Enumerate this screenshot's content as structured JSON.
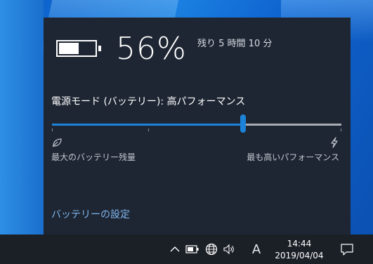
{
  "flyout": {
    "battery_percent": "56%",
    "time_remaining": "残り 5 時間 10 分",
    "battery_level": 0.56,
    "battery_icon": "battery-icon",
    "power_mode_label": "電源モード (バッテリー): 高パフォーマンス",
    "slider": {
      "level": 0.66,
      "active_color": "#1d83d8",
      "track_color": "#a8adb4",
      "left_label": "最大のバッテリー残量",
      "left_icon": "leaf-icon",
      "right_label": "最も高いパフォーマンス",
      "right_icon": "lightning-icon"
    },
    "settings_link": "バッテリーの設定",
    "link_color": "#7fb6ee",
    "background": "#1e2633"
  },
  "taskbar": {
    "tray_icons": [
      "chevron-up-icon",
      "battery-icon",
      "network-globe-icon",
      "volume-icon"
    ],
    "ime_indicator": "A",
    "clock": {
      "time": "14:44",
      "date": "2019/04/04"
    },
    "notification_icon": "action-center-icon",
    "background": "#1b2027"
  }
}
